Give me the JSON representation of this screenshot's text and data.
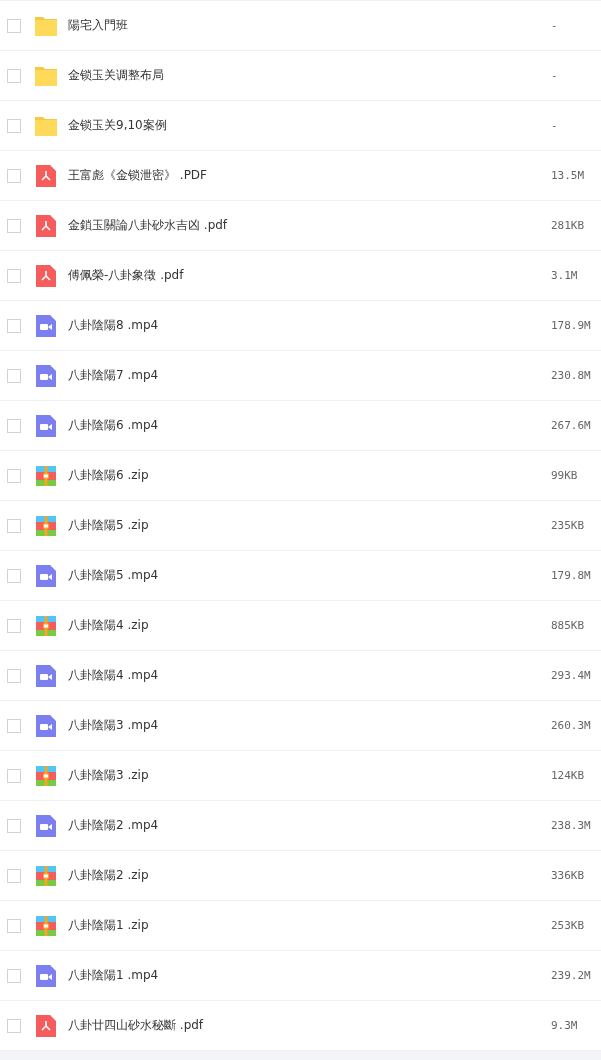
{
  "files": [
    {
      "kind": "folder",
      "name": "陽宅入門班",
      "size": "-",
      "checked": false
    },
    {
      "kind": "folder",
      "name": "金锁玉关调整布局",
      "size": "-",
      "checked": false
    },
    {
      "kind": "folder",
      "name": "金锁玉关9,10案例",
      "size": "-",
      "checked": false
    },
    {
      "kind": "pdf",
      "name": "王富彪《金锁泄密》 .PDF",
      "size": "13.5M",
      "checked": false
    },
    {
      "kind": "pdf",
      "name": "金鎖玉關論八卦砂水吉凶 .pdf",
      "size": "281KB",
      "checked": false
    },
    {
      "kind": "pdf",
      "name": "傅佩榮-八卦象徵 .pdf",
      "size": "3.1M",
      "checked": false
    },
    {
      "kind": "video",
      "name": "八卦陰陽8 .mp4",
      "size": "178.9M",
      "checked": false
    },
    {
      "kind": "video",
      "name": "八卦陰陽7 .mp4",
      "size": "230.8M",
      "checked": false
    },
    {
      "kind": "video",
      "name": "八卦陰陽6 .mp4",
      "size": "267.6M",
      "checked": false
    },
    {
      "kind": "zip",
      "name": "八卦陰陽6 .zip",
      "size": "99KB",
      "checked": false
    },
    {
      "kind": "zip",
      "name": "八卦陰陽5 .zip",
      "size": "235KB",
      "checked": false
    },
    {
      "kind": "video",
      "name": "八卦陰陽5 .mp4",
      "size": "179.8M",
      "checked": false
    },
    {
      "kind": "zip",
      "name": "八卦陰陽4 .zip",
      "size": "885KB",
      "checked": false
    },
    {
      "kind": "video",
      "name": "八卦陰陽4 .mp4",
      "size": "293.4M",
      "checked": false
    },
    {
      "kind": "video",
      "name": "八卦陰陽3 .mp4",
      "size": "260.3M",
      "checked": false
    },
    {
      "kind": "zip",
      "name": "八卦陰陽3 .zip",
      "size": "124KB",
      "checked": false
    },
    {
      "kind": "video",
      "name": "八卦陰陽2 .mp4",
      "size": "238.3M",
      "checked": false
    },
    {
      "kind": "zip",
      "name": "八卦陰陽2 .zip",
      "size": "336KB",
      "checked": false
    },
    {
      "kind": "zip",
      "name": "八卦陰陽1 .zip",
      "size": "253KB",
      "checked": false
    },
    {
      "kind": "video",
      "name": "八卦陰陽1 .mp4",
      "size": "239.2M",
      "checked": false
    },
    {
      "kind": "pdf",
      "name": "八卦廿四山砂水秘斷 .pdf",
      "size": "9.3M",
      "checked": false
    }
  ]
}
